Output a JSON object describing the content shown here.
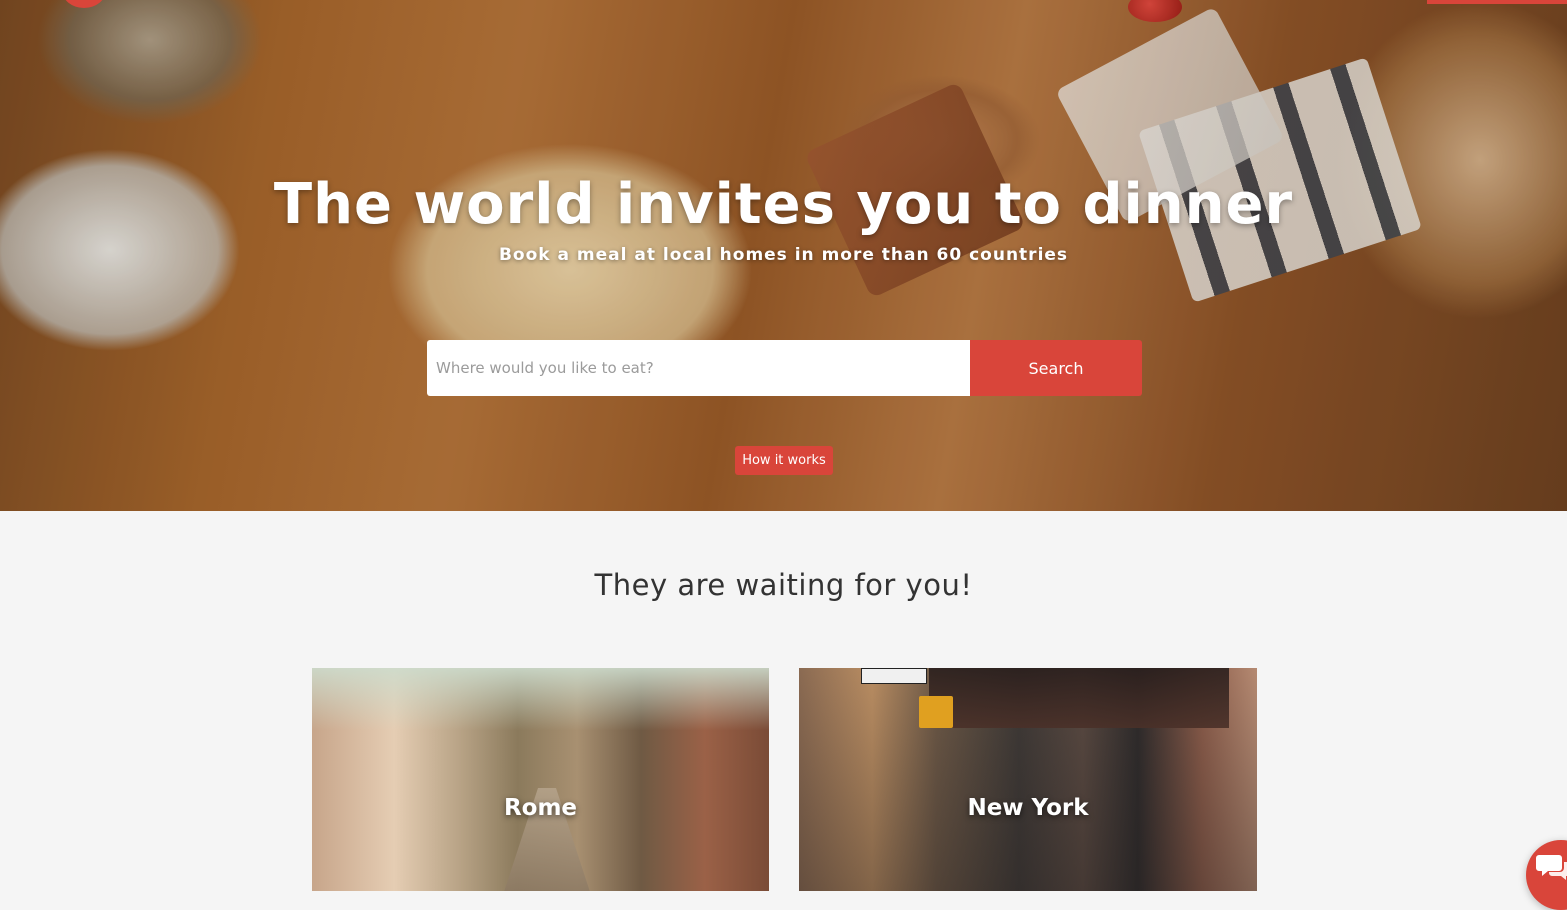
{
  "hero": {
    "title": "The world invites you to dinner",
    "subtitle": "Book a meal at local homes in more than 60 countries",
    "search": {
      "placeholder": "Where would you like to eat?",
      "value": "",
      "button_label": "Search"
    },
    "how_it_works_label": "How it works"
  },
  "section": {
    "title": "They are waiting for you!",
    "cities": [
      {
        "name": "Rome"
      },
      {
        "name": "New York"
      }
    ]
  },
  "icons": {
    "chat": "chat-bubbles-icon",
    "logo": "brand-logo"
  },
  "colors": {
    "accent": "#d9453a",
    "page_background": "#f5f5f5",
    "heading_text": "#333333"
  }
}
